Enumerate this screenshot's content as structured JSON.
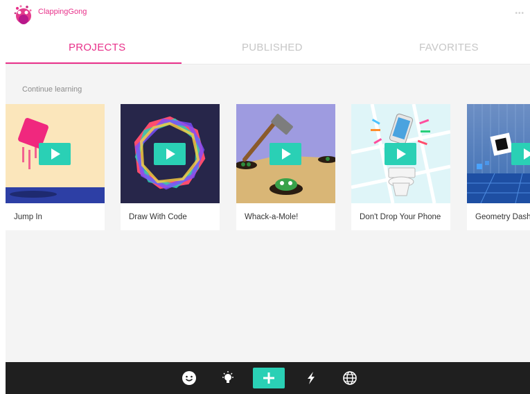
{
  "header": {
    "username": "ClappingGong",
    "more_icon": "ellipsis-icon",
    "more_text": "•••"
  },
  "tabs": [
    {
      "label": "PROJECTS",
      "active": true
    },
    {
      "label": "PUBLISHED",
      "active": false
    },
    {
      "label": "FAVORITES",
      "active": false
    }
  ],
  "main": {
    "section_title": "Continue learning",
    "cards": [
      {
        "title": "Jump In"
      },
      {
        "title": "Draw With Code"
      },
      {
        "title": "Whack-a-Mole!"
      },
      {
        "title": "Don't Drop Your Phone"
      },
      {
        "title": "Geometry Dash"
      }
    ]
  },
  "bottom_nav": [
    {
      "icon": "smiley-face-icon"
    },
    {
      "icon": "lightbulb-icon"
    },
    {
      "icon": "plus-icon"
    },
    {
      "icon": "lightning-bolt-icon"
    },
    {
      "icon": "globe-icon"
    }
  ],
  "colors": {
    "accent": "#e8318a",
    "play": "#2ad0b5",
    "bottom_bar": "#1f1f1f"
  }
}
